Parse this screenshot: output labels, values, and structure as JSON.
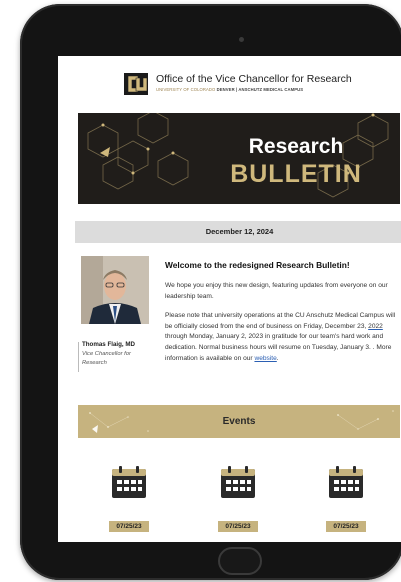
{
  "header": {
    "title": "Office of the Vice Chancellor for Research",
    "subtitle_a": "UNIVERSITY OF COLORADO",
    "subtitle_b": "DENVER | ANSCHUTZ MEDICAL CAMPUS",
    "logo_icon": "cu-logo-icon"
  },
  "banner": {
    "title": "Research",
    "subtitle": "BULLETIN"
  },
  "date": "December 12, 2024",
  "profile": {
    "name": "Thomas Flaig, MD",
    "role": "Vice Chancellor for Research"
  },
  "article": {
    "heading": "Welcome to the redesigned Research Bulletin!",
    "para1": "We hope you enjoy this new design, featuring updates from everyone on our leadership team.",
    "para2_a": "Please note that university operations at the CU Anschutz Medical Campus will be officially closed from the end of business on Friday, December 23, ",
    "para2_year": "2022",
    "para2_b": " through Monday, January 2, 2023 in gratitude for our team's hard work and dedication. Normal business hours will resume on Tuesday, January 3. . More information is available on our ",
    "para2_link": "website",
    "para2_end": "."
  },
  "events": {
    "heading": "Events",
    "items": [
      {
        "date": "07/25/23",
        "icon": "calendar-icon"
      },
      {
        "date": "07/25/23",
        "icon": "calendar-icon"
      },
      {
        "date": "07/25/23",
        "icon": "calendar-icon"
      }
    ]
  },
  "colors": {
    "gold": "#CFB87C",
    "dark": "#201D1A",
    "link": "#2B5FB3"
  }
}
